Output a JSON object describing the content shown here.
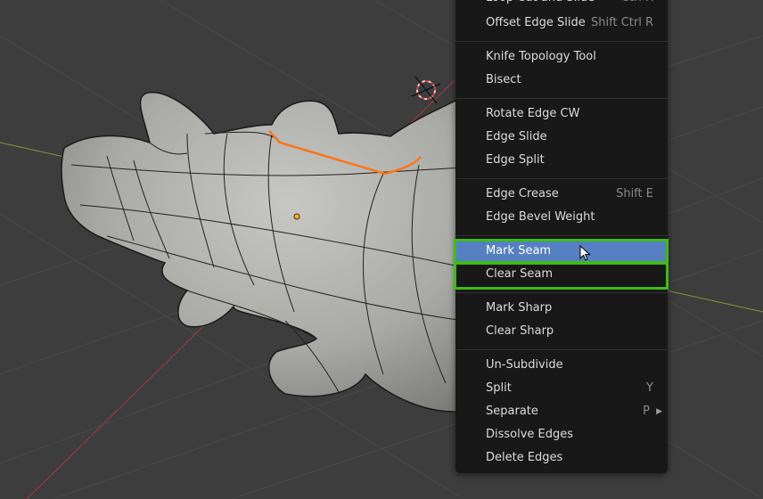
{
  "edge_menu": {
    "items": [
      {
        "label": "Loop Cut and Slide",
        "shortcut": "Ctrl R"
      },
      {
        "label": "Offset Edge Slide",
        "shortcut": "Shift Ctrl R"
      },
      {
        "label": "Knife Topology Tool",
        "shortcut": ""
      },
      {
        "label": "Bisect",
        "shortcut": ""
      },
      {
        "label": "Rotate Edge CW",
        "shortcut": ""
      },
      {
        "label": "Edge Slide",
        "shortcut": ""
      },
      {
        "label": "Edge Split",
        "shortcut": ""
      },
      {
        "label": "Edge Crease",
        "shortcut": "Shift E"
      },
      {
        "label": "Edge Bevel Weight",
        "shortcut": ""
      },
      {
        "label": "Mark Seam",
        "shortcut": ""
      },
      {
        "label": "Clear Seam",
        "shortcut": ""
      },
      {
        "label": "Mark Sharp",
        "shortcut": ""
      },
      {
        "label": "Clear Sharp",
        "shortcut": ""
      },
      {
        "label": "Un-Subdivide",
        "shortcut": ""
      },
      {
        "label": "Split",
        "shortcut": "Y"
      },
      {
        "label": "Separate",
        "shortcut": "P"
      },
      {
        "label": "Dissolve Edges",
        "shortcut": ""
      },
      {
        "label": "Delete Edges",
        "shortcut": ""
      }
    ]
  },
  "highlight_color": "#3dbc16",
  "active_color": "#5680c2",
  "icons": {
    "cursor": "mouse-pointer-icon",
    "cursor3d": "3d-cursor-icon",
    "origin": "object-origin-dot",
    "submenu": "submenu-arrow-icon"
  }
}
